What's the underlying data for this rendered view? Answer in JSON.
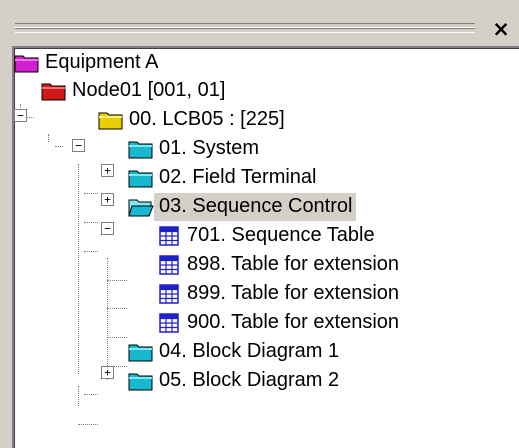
{
  "window": {
    "close_glyph": "×"
  },
  "tree": {
    "root": {
      "label": "Equipment A",
      "icon": "folder-magenta-icon"
    },
    "node01": {
      "label": "Node01 [001, 01]",
      "expander": "−",
      "icon": "folder-red-icon"
    },
    "lcb05": {
      "label": "00. LCB05 : [225]",
      "expander": "−",
      "icon": "folder-yellow-icon"
    },
    "system": {
      "label": "01. System",
      "expander": "+",
      "icon": "folder-cyan-icon"
    },
    "field_terminal": {
      "label": "02. Field Terminal",
      "expander": "+",
      "icon": "folder-cyan-icon"
    },
    "sequence_control": {
      "label": "03. Sequence Control",
      "expander": "−",
      "icon": "folder-open-cyan-icon",
      "selected": true
    },
    "table_701": {
      "label": "701. Sequence Table",
      "icon": "table-grid-icon"
    },
    "table_898": {
      "label": "898. Table for extension",
      "icon": "table-grid-icon"
    },
    "table_899": {
      "label": "899. Table for extension",
      "icon": "table-grid-icon"
    },
    "table_900": {
      "label": "900. Table for extension",
      "icon": "table-grid-icon"
    },
    "block_diagram_1": {
      "label": "04. Block Diagram 1",
      "expander": "+",
      "icon": "folder-cyan-icon"
    },
    "block_diagram_2": {
      "label": "05. Block Diagram 2",
      "icon": "folder-cyan-icon"
    }
  },
  "colors": {
    "selection_bg": "#d4d0c8",
    "folder_magenta": "#d020d0",
    "folder_red": "#d01818",
    "folder_yellow": "#e8d000",
    "folder_cyan": "#18b8d0",
    "table_blue": "#2020c8"
  }
}
